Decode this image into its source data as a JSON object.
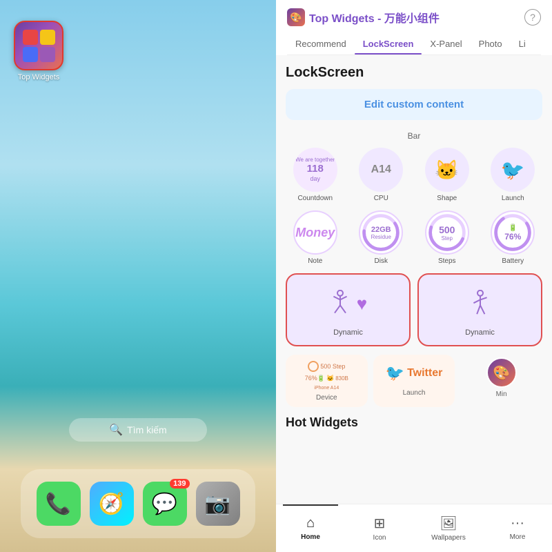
{
  "left": {
    "app_name": "Top Widgets",
    "search_placeholder": "Tìm kiếm",
    "dock": {
      "icons": [
        {
          "name": "Phone",
          "type": "phone",
          "badge": null
        },
        {
          "name": "Safari",
          "type": "safari",
          "badge": null
        },
        {
          "name": "Messages",
          "type": "messages",
          "badge": "139"
        },
        {
          "name": "Camera",
          "type": "camera",
          "badge": null
        }
      ]
    }
  },
  "right": {
    "header": {
      "app_title": "Top Widgets - 万能小组件",
      "help_icon": "?",
      "tabs": [
        "Recommend",
        "LockScreen",
        "X-Panel",
        "Photo",
        "Li"
      ],
      "active_tab": "LockScreen"
    },
    "section_title": "LockScreen",
    "edit_button_label": "Edit custom content",
    "bar_label": "Bar",
    "widgets_row1": [
      {
        "id": "countdown",
        "label": "Countdown",
        "top_text": "We are together",
        "big_text": "118",
        "suffix": "day"
      },
      {
        "id": "cpu",
        "label": "CPU",
        "apple": "",
        "text": "A14"
      },
      {
        "id": "shape",
        "label": "Shape"
      },
      {
        "id": "launch",
        "label": "Launch"
      }
    ],
    "widgets_row2": [
      {
        "id": "note",
        "label": "Note",
        "text": "Money"
      },
      {
        "id": "disk",
        "label": "Disk",
        "gb": "22GB",
        "res": "Residue"
      },
      {
        "id": "steps",
        "label": "Steps",
        "num": "500",
        "step_text": "Step"
      },
      {
        "id": "battery",
        "label": "Battery",
        "pct": "76%"
      }
    ],
    "dynamic": [
      {
        "id": "dynamic1",
        "label": "Dynamic",
        "selected": true
      },
      {
        "id": "dynamic2",
        "label": "Dynamic",
        "selected": true
      }
    ],
    "bottom_cards": [
      {
        "id": "device",
        "label": "Device"
      },
      {
        "id": "launch2",
        "label": "Launch"
      },
      {
        "id": "min",
        "label": "Min"
      }
    ],
    "hot_widgets_title": "Hot Widgets",
    "bottom_nav": [
      {
        "id": "home",
        "label": "Home",
        "icon": "⌂",
        "active": true
      },
      {
        "id": "icon",
        "label": "Icon",
        "icon": "⊞",
        "active": false
      },
      {
        "id": "wallpapers",
        "label": "Wallpapers",
        "icon": "□",
        "active": false
      },
      {
        "id": "more",
        "label": "More",
        "icon": "···",
        "active": false
      }
    ]
  }
}
